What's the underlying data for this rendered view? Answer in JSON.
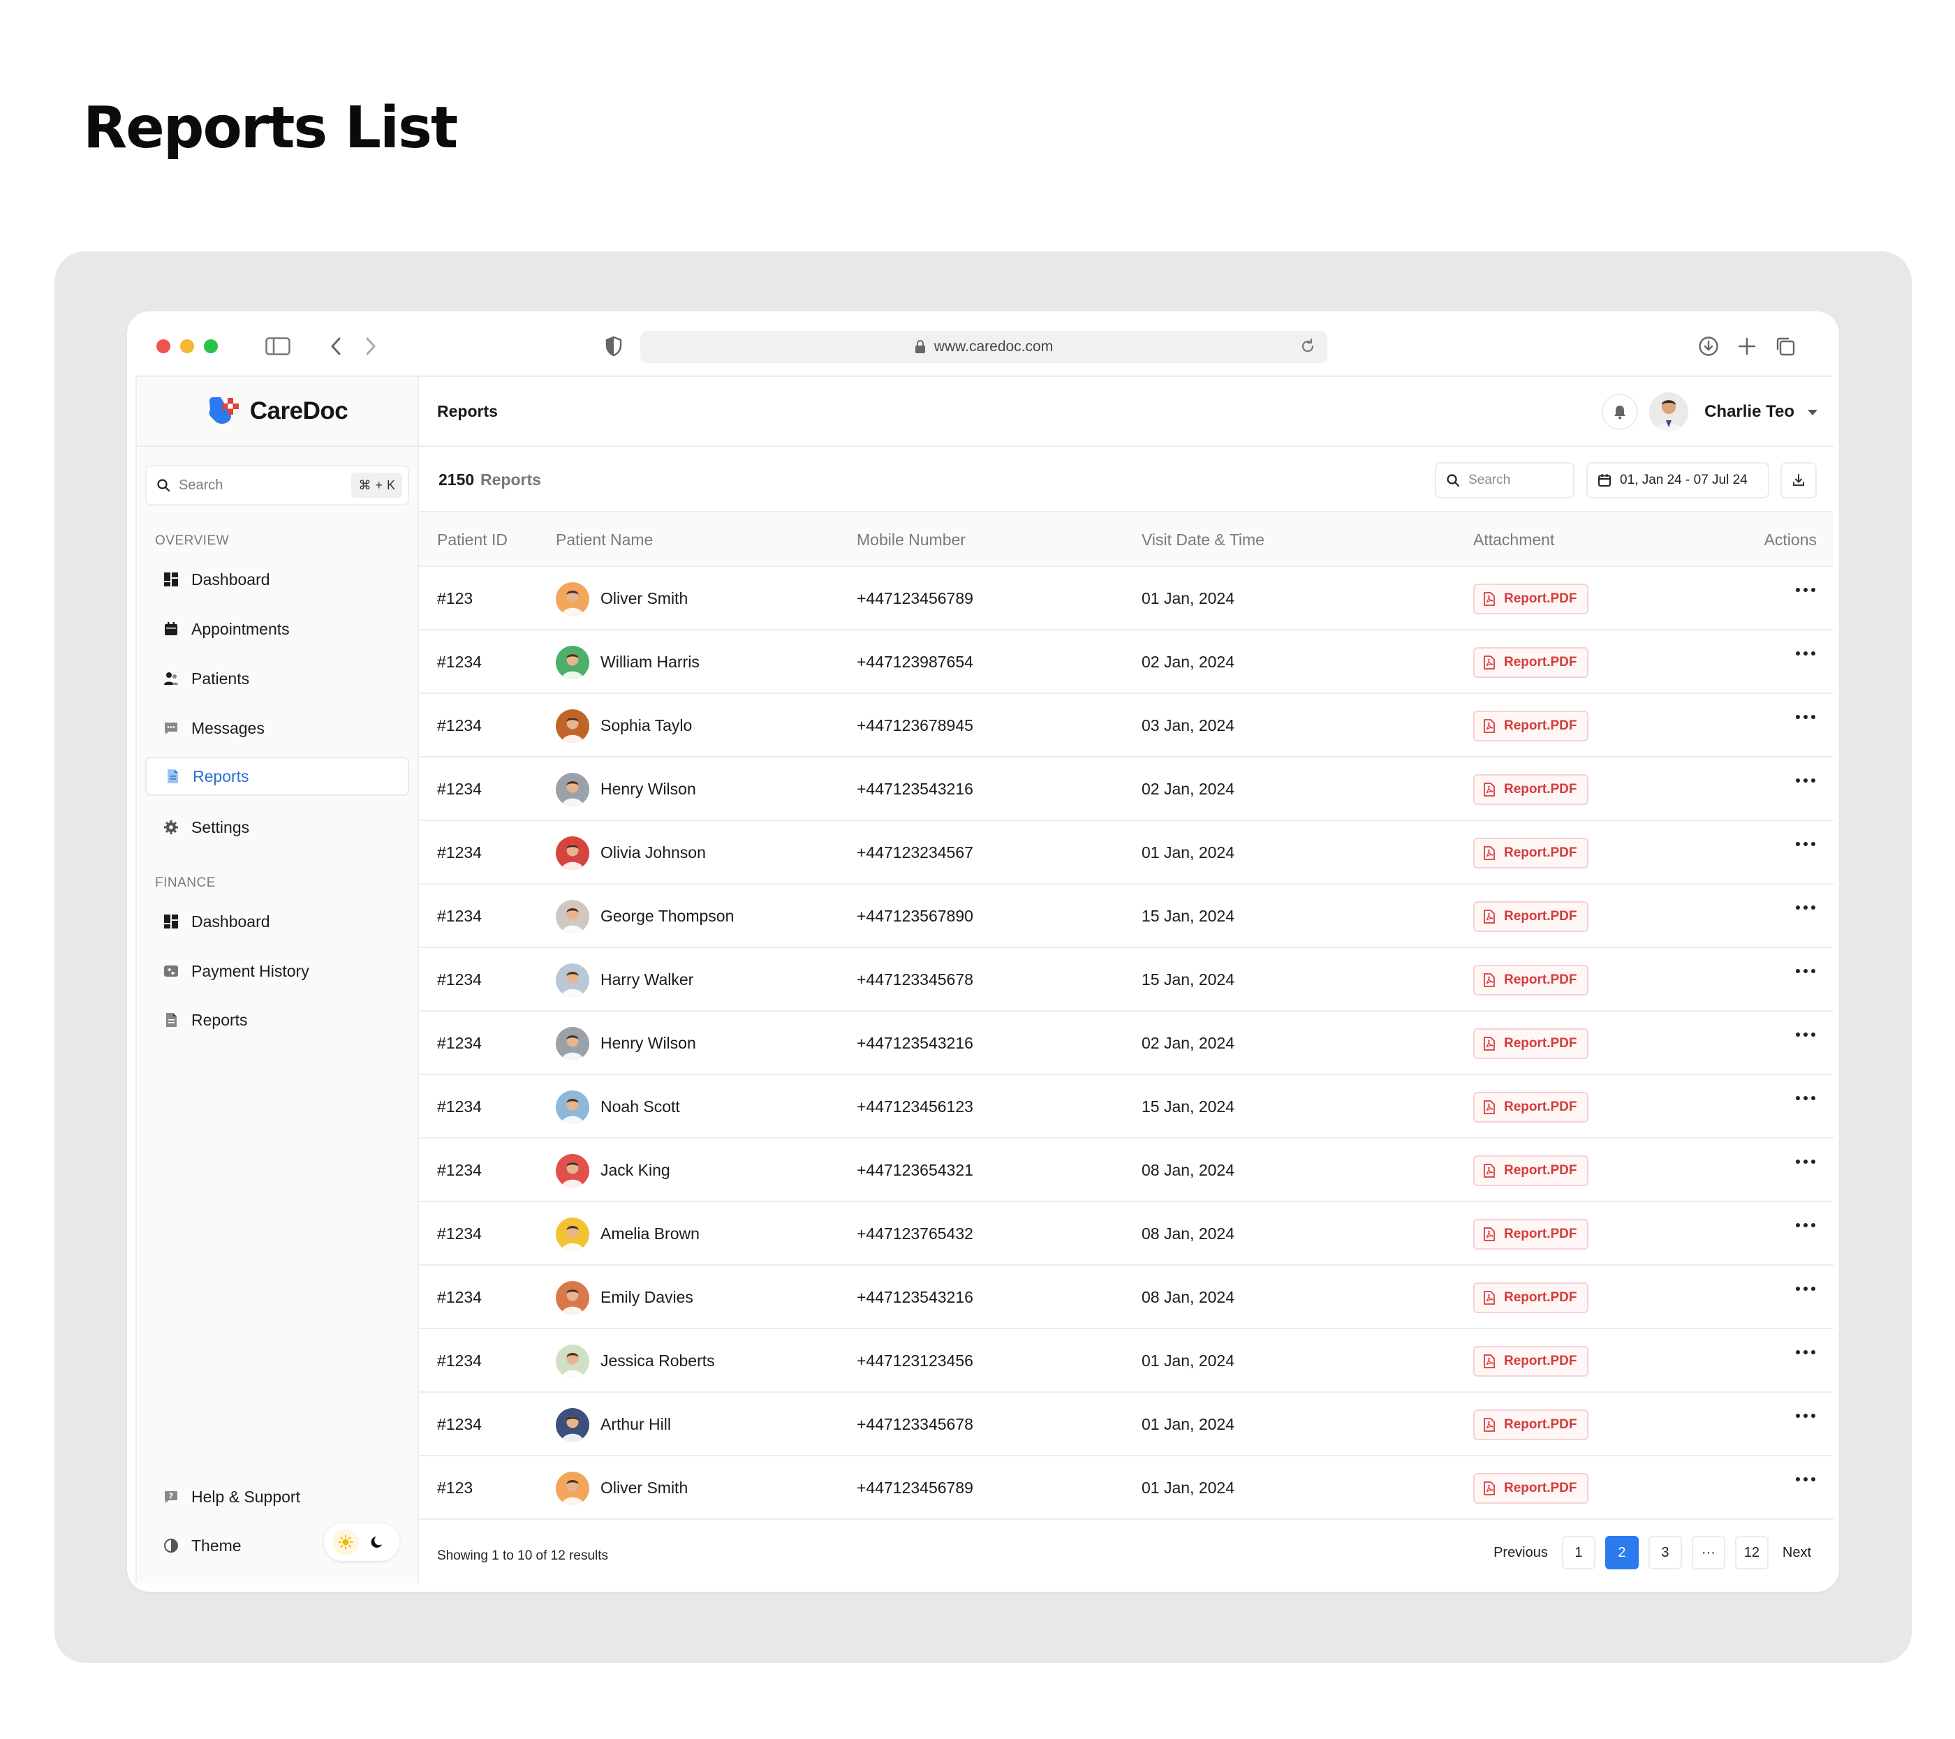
{
  "page": {
    "heading": "Reports List"
  },
  "browser": {
    "url": "www.caredoc.com"
  },
  "brand": {
    "name": "CareDoc"
  },
  "sidebar": {
    "search_placeholder": "Search",
    "shortcut_symbol": "⌘",
    "shortcut_plus": "+",
    "shortcut_key": "K",
    "overview_label": "OVERVIEW",
    "overview_items": [
      {
        "label": "Dashboard",
        "icon": "dashboard-icon"
      },
      {
        "label": "Appointments",
        "icon": "calendar-icon"
      },
      {
        "label": "Patients",
        "icon": "users-icon"
      },
      {
        "label": "Messages",
        "icon": "message-icon"
      },
      {
        "label": "Reports",
        "icon": "document-icon",
        "active": true
      },
      {
        "label": "Settings",
        "icon": "gear-icon"
      }
    ],
    "finance_label": "FINANCE",
    "finance_items": [
      {
        "label": "Dashboard",
        "icon": "dashboard-icon"
      },
      {
        "label": "Payment History",
        "icon": "payment-icon"
      },
      {
        "label": "Reports",
        "icon": "document-icon"
      }
    ],
    "help_label": "Help & Support",
    "theme_label": "Theme"
  },
  "topbar": {
    "title": "Reports",
    "user_name": "Charlie Teo"
  },
  "toolbar": {
    "count": "2150",
    "count_label": "Reports",
    "search_placeholder": "Search",
    "date_range": "01, Jan 24 - 07 Jul 24"
  },
  "table": {
    "headers": [
      "Patient ID",
      "Patient Name",
      "Mobile Number",
      "Visit Date & Time",
      "Attachment",
      "Actions"
    ],
    "rows": [
      {
        "id": "#123",
        "name": "Oliver Smith",
        "mobile": "+447123456789",
        "date": "01 Jan, 2024",
        "attachment": "Report.PDF",
        "avatar_color": "#f2a65a"
      },
      {
        "id": "#1234",
        "name": "William Harris",
        "mobile": "+447123987654",
        "date": "02 Jan, 2024",
        "attachment": "Report.PDF",
        "avatar_color": "#4caf6a"
      },
      {
        "id": "#1234",
        "name": "Sophia Taylo",
        "mobile": "+447123678945",
        "date": "03 Jan, 2024",
        "attachment": "Report.PDF",
        "avatar_color": "#c0642a"
      },
      {
        "id": "#1234",
        "name": "Henry Wilson",
        "mobile": "+447123543216",
        "date": "02 Jan, 2024",
        "attachment": "Report.PDF",
        "avatar_color": "#9aa1a8"
      },
      {
        "id": "#1234",
        "name": "Olivia Johnson",
        "mobile": "+447123234567",
        "date": "01 Jan, 2024",
        "attachment": "Report.PDF",
        "avatar_color": "#d7443e"
      },
      {
        "id": "#1234",
        "name": "George Thompson",
        "mobile": "+447123567890",
        "date": "15 Jan, 2024",
        "attachment": "Report.PDF",
        "avatar_color": "#cfc8c0"
      },
      {
        "id": "#1234",
        "name": "Harry Walker",
        "mobile": "+447123345678",
        "date": "15 Jan, 2024",
        "attachment": "Report.PDF",
        "avatar_color": "#b9c7d6"
      },
      {
        "id": "#1234",
        "name": "Henry Wilson",
        "mobile": "+447123543216",
        "date": "02 Jan, 2024",
        "attachment": "Report.PDF",
        "avatar_color": "#9aa1a8"
      },
      {
        "id": "#1234",
        "name": "Noah Scott",
        "mobile": "+447123456123",
        "date": "15 Jan, 2024",
        "attachment": "Report.PDF",
        "avatar_color": "#8fb7d8"
      },
      {
        "id": "#1234",
        "name": "Jack King",
        "mobile": "+447123654321",
        "date": "08 Jan, 2024",
        "attachment": "Report.PDF",
        "avatar_color": "#e3504a"
      },
      {
        "id": "#1234",
        "name": "Amelia Brown",
        "mobile": "+447123765432",
        "date": "08 Jan, 2024",
        "attachment": "Report.PDF",
        "avatar_color": "#f2c232"
      },
      {
        "id": "#1234",
        "name": "Emily Davies",
        "mobile": "+447123543216",
        "date": "08 Jan, 2024",
        "attachment": "Report.PDF",
        "avatar_color": "#d9784a"
      },
      {
        "id": "#1234",
        "name": "Jessica Roberts",
        "mobile": "+447123123456",
        "date": "01 Jan, 2024",
        "attachment": "Report.PDF",
        "avatar_color": "#cfe0c6"
      },
      {
        "id": "#1234",
        "name": "Arthur Hill",
        "mobile": "+447123345678",
        "date": "01 Jan, 2024",
        "attachment": "Report.PDF",
        "avatar_color": "#3d4f7a"
      },
      {
        "id": "#123",
        "name": "Oliver Smith",
        "mobile": "+447123456789",
        "date": "01 Jan, 2024",
        "attachment": "Report.PDF",
        "avatar_color": "#f2a65a"
      }
    ]
  },
  "footer": {
    "showing": "Showing 1 to 10 of 12 results",
    "previous": "Previous",
    "next": "Next",
    "pages": [
      "1",
      "2",
      "3",
      "···",
      "12"
    ],
    "active_page": "2"
  },
  "colors": {
    "accent": "#2b7bef",
    "active_nav": "#2b6fd3",
    "pdf_red": "#d63b3b"
  }
}
